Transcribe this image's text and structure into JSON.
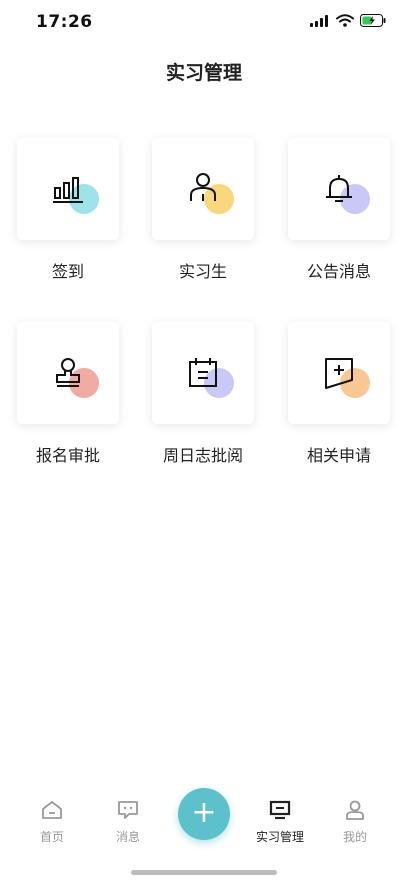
{
  "status": {
    "time": "17:26"
  },
  "page": {
    "title": "实习管理"
  },
  "grid": {
    "items": [
      {
        "label": "签到",
        "icon": "bar-chart-icon",
        "accent": "#9ee3ea"
      },
      {
        "label": "实习生",
        "icon": "person-icon",
        "accent": "#f8d77d"
      },
      {
        "label": "公告消息",
        "icon": "bell-icon",
        "accent": "#c9c9f7"
      },
      {
        "label": "报名审批",
        "icon": "stamp-icon",
        "accent": "#f2aba3"
      },
      {
        "label": "周日志批阅",
        "icon": "calendar-icon",
        "accent": "#c9c9f7"
      },
      {
        "label": "相关申请",
        "icon": "flag-add-icon",
        "accent": "#f7c891"
      }
    ]
  },
  "tabbar": {
    "tabs": [
      {
        "label": "首页",
        "icon": "home-icon"
      },
      {
        "label": "消息",
        "icon": "message-icon"
      },
      {
        "label": "实习管理",
        "icon": "monitor-icon",
        "active": true
      },
      {
        "label": "我的",
        "icon": "user-icon"
      }
    ],
    "fab_label": "+"
  }
}
